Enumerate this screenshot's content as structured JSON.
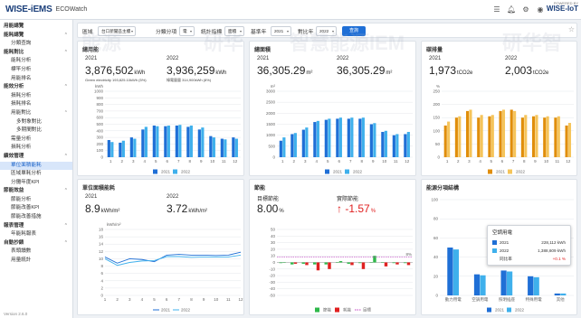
{
  "header": {
    "logo_main": "WISE-iEMS",
    "app_name": "ECOWatch",
    "powered_by": "POWERED BY",
    "powered_brand": "WISE-IoT",
    "icons": [
      "list-icon",
      "bell-icon",
      "settings-icon",
      "user-icon"
    ]
  },
  "sidebar": {
    "items": [
      {
        "label": "用能總覽",
        "level": 1,
        "chev": ""
      },
      {
        "label": "能耗總覽",
        "level": 1,
        "chev": "^"
      },
      {
        "label": "分類查詢",
        "level": 2,
        "chev": ""
      },
      {
        "label": "能耗對比",
        "level": 1,
        "chev": "^"
      },
      {
        "label": "能耗分析",
        "level": 2,
        "chev": ""
      },
      {
        "label": "標竿分析",
        "level": 2,
        "chev": ""
      },
      {
        "label": "用能排名",
        "level": 2,
        "chev": ""
      },
      {
        "label": "能效分析",
        "level": 1,
        "chev": "^"
      },
      {
        "label": "損耗分析",
        "level": 2,
        "chev": ""
      },
      {
        "label": "損耗排名",
        "level": 2,
        "chev": ""
      },
      {
        "label": "用能對比",
        "level": 2,
        "chev": "^"
      },
      {
        "label": "多對象對比",
        "level": 3,
        "chev": ""
      },
      {
        "label": "多期間對比",
        "level": 3,
        "chev": ""
      },
      {
        "label": "需量分析",
        "level": 2,
        "chev": ""
      },
      {
        "label": "損耗分析",
        "level": 2,
        "chev": ""
      },
      {
        "label": "績效管理",
        "level": 1,
        "chev": "^"
      },
      {
        "label": "單位面積能耗",
        "level": 2,
        "chev": "",
        "active": true
      },
      {
        "label": "區域單耗分析",
        "level": 2,
        "chev": ""
      },
      {
        "label": "分攤年度KPI",
        "level": 2,
        "chev": ""
      },
      {
        "label": "節能效益",
        "level": 1,
        "chev": "^"
      },
      {
        "label": "節能分析",
        "level": 2,
        "chev": ""
      },
      {
        "label": "節能改善KPI",
        "level": 2,
        "chev": ""
      },
      {
        "label": "節能改善措施",
        "level": 2,
        "chev": ""
      },
      {
        "label": "報表管理",
        "level": 1,
        "chev": "^"
      },
      {
        "label": "年能耗報表",
        "level": 2,
        "chev": ""
      },
      {
        "label": "自動抄錶",
        "level": 1,
        "chev": "^"
      },
      {
        "label": "表頭讀數",
        "level": 2,
        "chev": ""
      },
      {
        "label": "用量統計",
        "level": 2,
        "chev": ""
      }
    ],
    "version": "Version 2.6.0"
  },
  "filters": {
    "area_label": "區域",
    "area_value": "台口新聞區主樓",
    "category_label": "分類分項",
    "category_value": "電",
    "metric_label": "統計指標",
    "metric_value": "面積",
    "base_year_label": "基準年",
    "base_year_value": "2021",
    "compare_year_label": "對比年",
    "compare_year_value": "2022",
    "query_label": "查詢"
  },
  "watermarks": [
    "能源",
    "研华",
    "智慧能源IEM",
    "研华智"
  ],
  "cards": {
    "total": {
      "title": "總用能",
      "y1": "2021",
      "y2": "2022",
      "v1": "3,876,502",
      "u1": "kWh",
      "v2": "3,936,259",
      "u2": "kWh",
      "sub1": "Green electricity 193,825.10kWh (5%)",
      "sub2": "綠電量量 314,900kWh (8%)"
    },
    "area": {
      "title": "總面積",
      "y1": "2021",
      "y2": "2022",
      "v1": "36,305.29",
      "u1": "m²",
      "v2": "36,305.29",
      "u2": "m²"
    },
    "carbon": {
      "title": "碳排量",
      "y1": "2021",
      "y2": "2022",
      "v1": "1,973",
      "u1": "tCO2e",
      "v2": "2,003",
      "u2": "tCO2e"
    },
    "unit": {
      "title": "單位面積能耗",
      "y1": "2021",
      "y2": "2022",
      "v1": "8.9",
      "u1": "kWh/m²",
      "v2": "3.72",
      "u2": "kWh/m²"
    },
    "saving": {
      "title": "節能",
      "l1": "目標節能",
      "l2": "實際節能",
      "v1": "8.00",
      "u1": "%",
      "v2": "↑ -1.57",
      "u2": "%"
    },
    "breakdown": {
      "title": "能源分項結構"
    }
  },
  "tooltip": {
    "title": "空調用電",
    "r1_label": "2021",
    "r1_value": "228,112 kWh",
    "r2_label": "2022",
    "r2_value": "1,388,609 kWh",
    "r3_label": "同比率",
    "r3_value": "+0.1 %"
  },
  "colors": {
    "dark_blue": "#1f6fd6",
    "light_blue": "#3fb0ec",
    "dark_orange": "#e08e0b",
    "light_orange": "#f5c45a",
    "green": "#2eb84a",
    "red": "#e02020"
  },
  "chart_data": [
    {
      "type": "bar",
      "id": "total-energy",
      "categories": [
        "1",
        "2",
        "3",
        "4",
        "5",
        "6",
        "7",
        "8",
        "9",
        "10",
        "11",
        "12"
      ],
      "ylabel": "kWh",
      "ylim": [
        0,
        1000
      ],
      "yticks": [
        0,
        100,
        200,
        300,
        400,
        500,
        600,
        700,
        800,
        900,
        1000
      ],
      "series": [
        {
          "name": "2021",
          "values": [
            260,
            220,
            300,
            420,
            480,
            470,
            480,
            460,
            420,
            320,
            280,
            300
          ]
        },
        {
          "name": "2022",
          "values": [
            230,
            250,
            280,
            460,
            470,
            480,
            490,
            480,
            450,
            300,
            270,
            280
          ]
        }
      ]
    },
    {
      "type": "bar",
      "id": "total-area",
      "categories": [
        "1",
        "2",
        "3",
        "4",
        "5",
        "6",
        "7",
        "8",
        "9",
        "10",
        "11",
        "12"
      ],
      "ylabel": "m²",
      "ylim": [
        0,
        3000
      ],
      "yticks": [
        0,
        500,
        1000,
        1500,
        2000,
        2500,
        3000
      ],
      "series": [
        {
          "name": "2021",
          "values": [
            750,
            1050,
            1250,
            1600,
            1700,
            1750,
            1750,
            1750,
            1500,
            1150,
            1000,
            1050
          ]
        },
        {
          "name": "2022",
          "values": [
            900,
            1100,
            1350,
            1650,
            1750,
            1800,
            1800,
            1800,
            1550,
            1200,
            1050,
            1150
          ]
        }
      ]
    },
    {
      "type": "bar",
      "id": "carbon-emission",
      "categories": [
        "1",
        "2",
        "3",
        "4",
        "5",
        "6",
        "7",
        "8",
        "9",
        "10",
        "11",
        "12"
      ],
      "ylabel": "%",
      "ylim": [
        0,
        250
      ],
      "yticks": [
        0,
        50,
        100,
        150,
        200,
        250
      ],
      "series": [
        {
          "name": "2021",
          "values": [
            120,
            150,
            175,
            150,
            155,
            175,
            180,
            150,
            155,
            150,
            150,
            120
          ]
        },
        {
          "name": "2022",
          "values": [
            135,
            155,
            180,
            160,
            160,
            180,
            175,
            160,
            160,
            155,
            155,
            130
          ]
        }
      ]
    },
    {
      "type": "line",
      "id": "unit-area-energy",
      "categories": [
        "1",
        "2",
        "3",
        "4",
        "5",
        "6",
        "7",
        "8",
        "9",
        "10",
        "11",
        "12"
      ],
      "ylabel": "kWh/m²",
      "ylim": [
        0,
        18
      ],
      "yticks": [
        0,
        2,
        4,
        6,
        8,
        10,
        12,
        14,
        16,
        18
      ],
      "series": [
        {
          "name": "2021",
          "values": [
            10.5,
            8.8,
            10,
            9.8,
            9.2,
            11,
            11.2,
            11,
            11,
            10.9,
            11,
            11.8
          ]
        },
        {
          "name": "2022",
          "values": [
            10,
            8.2,
            9,
            9.4,
            9.5,
            10.6,
            10.6,
            10.4,
            10.5,
            10.5,
            10.5,
            11
          ]
        }
      ]
    },
    {
      "type": "bar",
      "id": "energy-saving",
      "categories": [
        "1",
        "2",
        "3",
        "4",
        "5",
        "6",
        "7",
        "8",
        "9",
        "10",
        "11",
        "12"
      ],
      "ylim": [
        -50,
        50
      ],
      "yticks": [
        -50,
        -40,
        -30,
        -20,
        -10,
        0,
        10,
        20,
        30,
        40,
        50
      ],
      "target": 8,
      "target_label": "8%",
      "series": [
        {
          "name": "節能",
          "values": [
            -1,
            -3,
            -2,
            -3,
            -3,
            0,
            -2,
            -1,
            0,
            0,
            -1,
            -1
          ]
        },
        {
          "name": "耗能",
          "values": [
            0,
            -2,
            -4,
            -12,
            -10,
            2,
            -4,
            -10,
            10,
            -6,
            -3,
            -4
          ]
        },
        {
          "name": "目標",
          "values": [
            8,
            8,
            8,
            8,
            8,
            8,
            8,
            8,
            8,
            8,
            8,
            8
          ]
        }
      ]
    },
    {
      "type": "bar",
      "id": "energy-breakdown",
      "categories": [
        "動力用電",
        "空調用電",
        "照明插座",
        "特殊用電",
        "其他"
      ],
      "ylim": [
        0,
        100
      ],
      "yticks": [
        0,
        20,
        40,
        60,
        80,
        100
      ],
      "series": [
        {
          "name": "2021",
          "values": [
            50,
            22,
            26,
            20,
            2
          ]
        },
        {
          "name": "2022",
          "values": [
            48,
            21,
            25,
            19,
            2
          ]
        }
      ]
    }
  ]
}
